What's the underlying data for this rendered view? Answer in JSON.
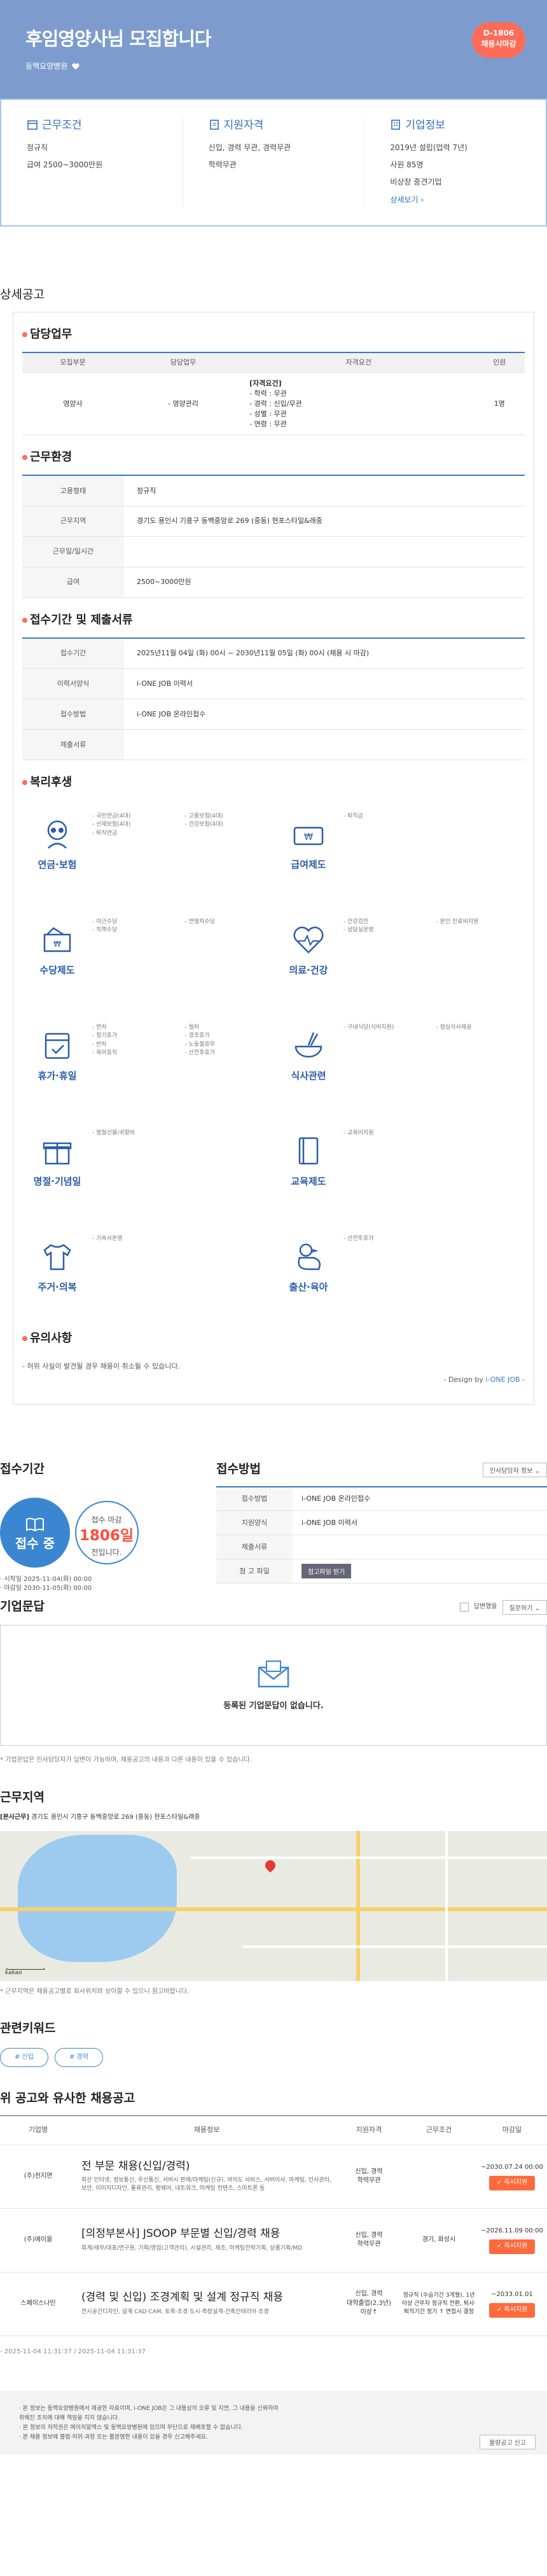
{
  "hero": {
    "title": "후임영양사님 모집합니다",
    "company": "동백요양병원",
    "badge_line1": "D-1806",
    "badge_line2": "채용시마감"
  },
  "info": [
    {
      "title": "근무조건",
      "lines": [
        "정규직",
        "급여 2500~3000만원"
      ]
    },
    {
      "title": "지원자격",
      "lines": [
        "신입, 경력 무관, 경력무관",
        "학력무관"
      ]
    },
    {
      "title": "기업정보",
      "lines": [
        "2019년 설립(업력 7년)",
        "사원 85명",
        "비상장 중견기업"
      ],
      "link": "상세보기 ›"
    }
  ],
  "detail_label": "상세공고",
  "duty": {
    "heading": "담당업무",
    "cols": [
      "모집부문",
      "담당업무",
      "자격요건",
      "인원"
    ],
    "row": {
      "dept": "영양사",
      "task": "- 영양관리",
      "quals": [
        "[자격요건]",
        "- 학력 : 무관",
        "- 경력 : 신입/무관",
        "- 성별 : 무관",
        "- 연령 : 무관"
      ],
      "count": "1명"
    }
  },
  "env": {
    "heading": "근무환경",
    "rows": [
      [
        "고용형태",
        "정규직"
      ],
      [
        "근무지역",
        "경기도 용인시 기흥구 동백중앙로 269 (중동) 현포스타일&래중"
      ],
      [
        "근무일/일시간",
        ""
      ],
      [
        "급여",
        "2500~3000만원"
      ]
    ]
  },
  "receipt": {
    "heading": "접수기간 및 제출서류",
    "rows": [
      [
        "접수기간",
        "2025년11월 04일 (화) 00시 ~ 2030년11월 05일 (화) 00시 (채용 시 마감)"
      ],
      [
        "이력서양식",
        "i-ONE JOB 이력서"
      ],
      [
        "접수방법",
        "i-ONE JOB 온라인접수"
      ],
      [
        "제출서류",
        ""
      ]
    ]
  },
  "welfare": {
    "heading": "복리후생",
    "items": [
      {
        "label": "연금·보험",
        "list": [
          "- 국민연금(4대)",
          "- 고용보험(4대)",
          "- 산재보험(4대)",
          "- 건강보험(4대)",
          "- 퇴직연금",
          ""
        ]
      },
      {
        "label": "급여제도",
        "list": [
          "- 퇴직금",
          ""
        ]
      },
      {
        "label": "수당제도",
        "list": [
          "- 야근수당",
          "- 연월차수당",
          "- 직책수당",
          ""
        ]
      },
      {
        "label": "의료·건강",
        "list": [
          "- 건강검진",
          "- 본인 진료비지원",
          "- 상담실운영",
          ""
        ]
      },
      {
        "label": "휴가·휴일",
        "list": [
          "- 연차",
          "- 월차",
          "- 정기휴가",
          "- 경조휴가",
          "- 반차",
          "- 노동절휴무",
          "- 육아휴직",
          "- 산전후휴가"
        ]
      },
      {
        "label": "식사관련",
        "list": [
          "- 구내식당(식비지원)",
          "- 점심식사제공"
        ]
      },
      {
        "label": "명절·기념일",
        "list": [
          "- 명절선물/귀향비",
          ""
        ]
      },
      {
        "label": "교육제도",
        "list": [
          "- 교육비지원",
          ""
        ]
      },
      {
        "label": "주거·의복",
        "list": [
          "- 기숙사운영",
          ""
        ]
      },
      {
        "label": "출산·육아",
        "list": [
          "- 산전후휴가",
          ""
        ]
      }
    ]
  },
  "caution": {
    "heading": "유의사항",
    "text": "- 허위 사실이 발견될 경우 채용이 취소될 수 있습니다.",
    "design_prefix": "- Design by",
    "design_brand": "i-ONE JOB",
    "design_suffix": " -"
  },
  "apply": {
    "heading": "접수기간",
    "status": "접수 중",
    "dday_prefix": "접수 마감",
    "dday_value": "1806일",
    "dday_suffix": "전입니다.",
    "start": "· 시작일 2025-11-04(화) 00:00",
    "end": "· 마감일 2030-11-05(화) 00:00"
  },
  "method": {
    "heading": "접수방법",
    "guide": "인사담당자 정보 ⌄",
    "rows": [
      [
        "접수방법",
        "i-ONE JOB 온라인접수"
      ],
      [
        "지원양식",
        "i-ONE JOB 이력서"
      ],
      [
        "제출서류",
        ""
      ],
      [
        "첨 고 파일",
        ""
      ]
    ],
    "file_btn": "첨고파일 받기"
  },
  "qa": {
    "heading": "기업문답",
    "anonymous": "답변했을",
    "sort": "질문하기 ⌄",
    "empty": "등록된 기업문답이 없습니다.",
    "note": "* 기업문답은 인사담당자가 답변이 가능하며, 채용공고의 내용과 다른 내용이 있을 수 있습니다."
  },
  "location": {
    "heading": "근무지역",
    "address_label": "[본사근무]",
    "address": "경기도 용인시 기흥구 동백중앙로 269 (중동) 현포스타일&래중",
    "map_brand": "kakao",
    "note": "* 근무지역은 채용공고별로 회사위치와 상이할 수 있으니 참고바랍니다."
  },
  "keywords": {
    "heading": "관련키워드",
    "tags": [
      "# 신입",
      "# 경력"
    ]
  },
  "similar": {
    "heading": "위 공고와 유사한 채용공고",
    "cols": [
      "기업명",
      "채용정보",
      "지원자격",
      "근무조건",
      "마감일"
    ],
    "rows": [
      {
        "company": "(주)천지연",
        "title": "전 부문 채용(신입/경력)",
        "desc": "회산 인터넷, 정보통신, 우신통신, 서버시 판매/마케팅(신규), 여의도 서비스, 서버이사, 마케팅, 인사관리, 보안, 이미지디자인, 물류관리, 펌웨어, 네트워크, 마케팅 컨텐츠, 스마트폰 등",
        "qual": "신입, 경력\n학력무관",
        "cond": "",
        "deadline": "~2030.07.24 00:00",
        "btn": "✓ 즉시지원"
      },
      {
        "company": "(주)에이을",
        "title": "[의정부본사] JSOOP 부문별 신입/경력 채용",
        "desc": "회계/세무/대표/연구원, 기획/영업(고객관리), 시설관리, 제조, 마케팅전략기획, 상품기획/MD",
        "qual": "신입, 경력\n학력무관",
        "cond": "경기, 화성시",
        "deadline": "~2026.11.09 00:00",
        "btn": "✓ 즉시지원"
      },
      {
        "company": "스페이스나인",
        "title": "(경력 및 신입) 조경계획 및 설계 정규직 채용",
        "desc": "전시공간디자인, 설계 CAD·CAM, 토목·조경·도시·측량설계·건축인테리어·조경",
        "qual": "신입, 경력\n대학졸업(2,3년)\n이상↑",
        "cond": "정규직 (수습기간 3개월), 1년 이상 근무자 정규직 전환, 퇴사·퇴직기간 정기 ↑ 면접시 결정",
        "deadline": "~2033.01.01",
        "btn": "✓ 즉시지원"
      }
    ]
  },
  "stamp": "- 2025-11-04 11:31:37 / 2025-11-04 11:31:37",
  "footer": {
    "lines": [
      "· 본 정보는 동백요양병원에서 제공한 자료이며, i-ONE JOB은 그 내용상의 오류 및 지연, 그 내용을 신뢰하여",
      "  취해진 조치에 대해 책임을 지지 않습니다.",
      "· 본 정보의 저작권은 에이치알엑스 및 동백요양병원에 있으며 무단으로 재배포할 수 없습니다.",
      "· 본 채용 정보에 불법·허위·과장 또는 불분명한 내용이 있을 경우 신고해주세요."
    ],
    "report": "불량공고 신고"
  },
  "colors": {
    "hero": "#7d9ccd",
    "accent": "#3b78c4",
    "badge": "#ff6b57"
  }
}
